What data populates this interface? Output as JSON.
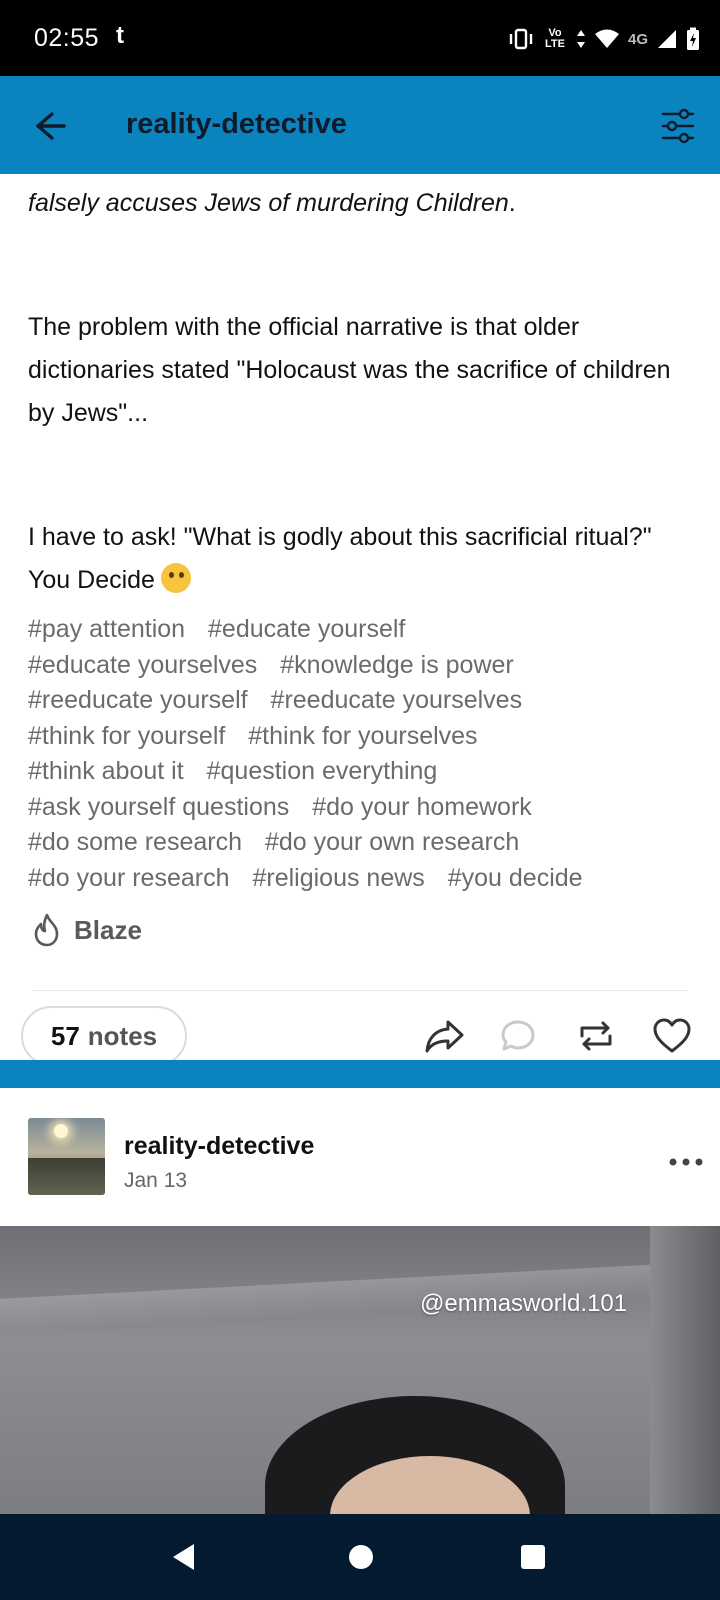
{
  "status_bar": {
    "time": "02:55",
    "notification_glyph": "t",
    "network_label": "Vo LTE",
    "network_4g": "4G"
  },
  "header": {
    "title": "reality-detective"
  },
  "post": {
    "text_italic": "falsely accuses Jews of murdering Children",
    "text_italic_end": ".",
    "paragraph_1": "The problem with the official narrative is that older dictionaries stated \"Holocaust was the sacrifice of children by Jews\"...",
    "paragraph_2": "I have to ask! \"What is godly about this sacrificial ritual?\"  You Decide",
    "emoji_name": "thinking-face",
    "tags": [
      "#pay attention",
      "#educate yourself",
      "#educate yourselves",
      "#knowledge is power",
      "#reeducate yourself",
      "#reeducate yourselves",
      "#think for yourself",
      "#think for yourselves",
      "#think about it",
      "#question everything",
      "#ask yourself questions",
      "#do your homework",
      "#do some research",
      "#do your own research",
      "#do your research",
      "#religious news",
      "#you decide"
    ],
    "blaze_label": "Blaze",
    "notes_count": "57",
    "notes_label": "notes"
  },
  "next_post": {
    "username": "reality-detective",
    "date": "Jan 13",
    "video_watermark": "@emmasworld.101"
  },
  "colors": {
    "header_bg": "#0a84bf",
    "nav_bg": "#041a30",
    "tag_color": "#6b6b6b"
  }
}
